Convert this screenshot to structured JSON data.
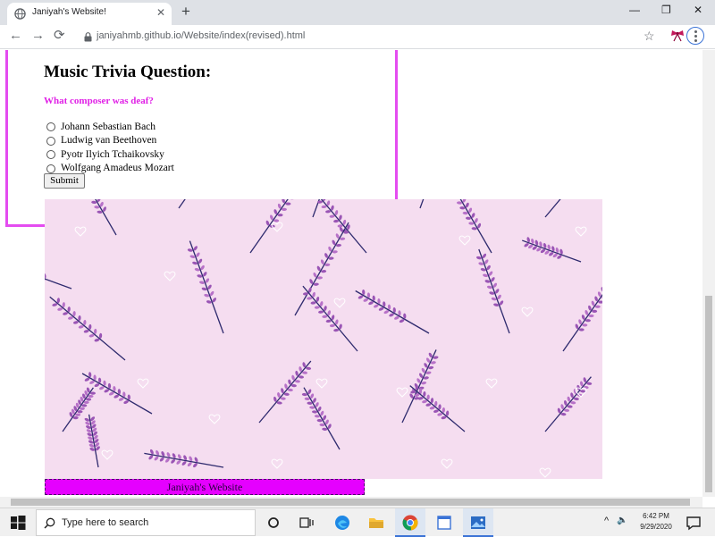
{
  "browser": {
    "tab_title": "Janiyah's Website!",
    "tab_close": "✕",
    "new_tab": "+",
    "url": "janiyahmb.github.io/Website/index(revised).html",
    "back": "←",
    "forward": "→",
    "reload": "⟳",
    "star": "☆",
    "minimize": "—",
    "restore": "❐",
    "close": "✕",
    "accent_color": "#3b73d6"
  },
  "page": {
    "trivia_title": "Music Trivia Question:",
    "question": "What composer was deaf?",
    "options": [
      "Johann Sebastian Bach",
      "Ludwig van Beethoven",
      "Pyotr Ilyich Tchaikovsky",
      "Wolfgang Amadeus Mozart"
    ],
    "submit_label": "Submit",
    "footer_text": "Janiyah's Website",
    "border_color": "#e44cf0",
    "footer_color": "#e500ff",
    "pattern_bg": "#f5ddf0"
  },
  "taskbar": {
    "search_placeholder": "Type here to search",
    "time": "6:42 PM",
    "date": "9/29/2020",
    "tray_arrow": "^",
    "speaker": "🔈"
  }
}
